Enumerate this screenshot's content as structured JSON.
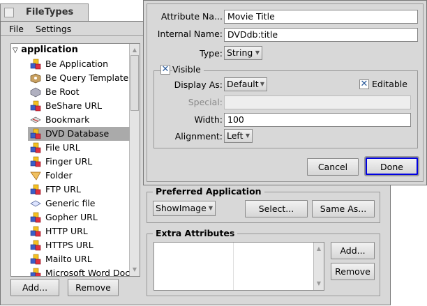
{
  "window": {
    "title": "FileTypes"
  },
  "menu": [
    "File",
    "Settings"
  ],
  "list": {
    "group": "application",
    "items": [
      {
        "label": "Be Application",
        "icon": "app-cubes-icon"
      },
      {
        "label": "Be Query Template",
        "icon": "query-icon"
      },
      {
        "label": "Be Root",
        "icon": "drive-icon"
      },
      {
        "label": "BeShare URL",
        "icon": "app-cubes-icon"
      },
      {
        "label": "Bookmark",
        "icon": "bookmark-icon"
      },
      {
        "label": "DVD Database",
        "icon": "app-cubes-icon",
        "selected": true
      },
      {
        "label": "File URL",
        "icon": "app-cubes-icon"
      },
      {
        "label": "Finger URL",
        "icon": "app-cubes-icon"
      },
      {
        "label": "Folder",
        "icon": "folder-icon"
      },
      {
        "label": "FTP URL",
        "icon": "app-cubes-icon"
      },
      {
        "label": "Generic file",
        "icon": "generic-file-icon"
      },
      {
        "label": "Gopher URL",
        "icon": "app-cubes-icon"
      },
      {
        "label": "HTTP URL",
        "icon": "app-cubes-icon"
      },
      {
        "label": "HTTPS URL",
        "icon": "app-cubes-icon"
      },
      {
        "label": "Mailto URL",
        "icon": "app-cubes-icon"
      },
      {
        "label": "Microsoft Word Doc",
        "icon": "app-cubes-icon"
      }
    ]
  },
  "list_buttons": {
    "add": "Add...",
    "remove": "Remove"
  },
  "preferred": {
    "title": "Preferred Application",
    "app": "ShowImage",
    "select": "Select...",
    "same_as": "Same As..."
  },
  "extra": {
    "title": "Extra Attributes",
    "add": "Add...",
    "remove": "Remove"
  },
  "dialog": {
    "attr_name_label": "Attribute Na...",
    "attr_name": "Movie Title",
    "internal_label": "Internal Name:",
    "internal": "DVDdb:title",
    "type_label": "Type:",
    "type": "String",
    "visible_label": "Visible",
    "visible": true,
    "display_label": "Display As:",
    "display": "Default",
    "editable_label": "Editable",
    "editable": true,
    "special_label": "Special:",
    "special": "",
    "width_label": "Width:",
    "width": "100",
    "align_label": "Alignment:",
    "align": "Left",
    "cancel": "Cancel",
    "done": "Done"
  },
  "colors": {
    "selection": "#aaaaaa",
    "default_button": "#0000e0",
    "check": "#2a5a9a"
  }
}
